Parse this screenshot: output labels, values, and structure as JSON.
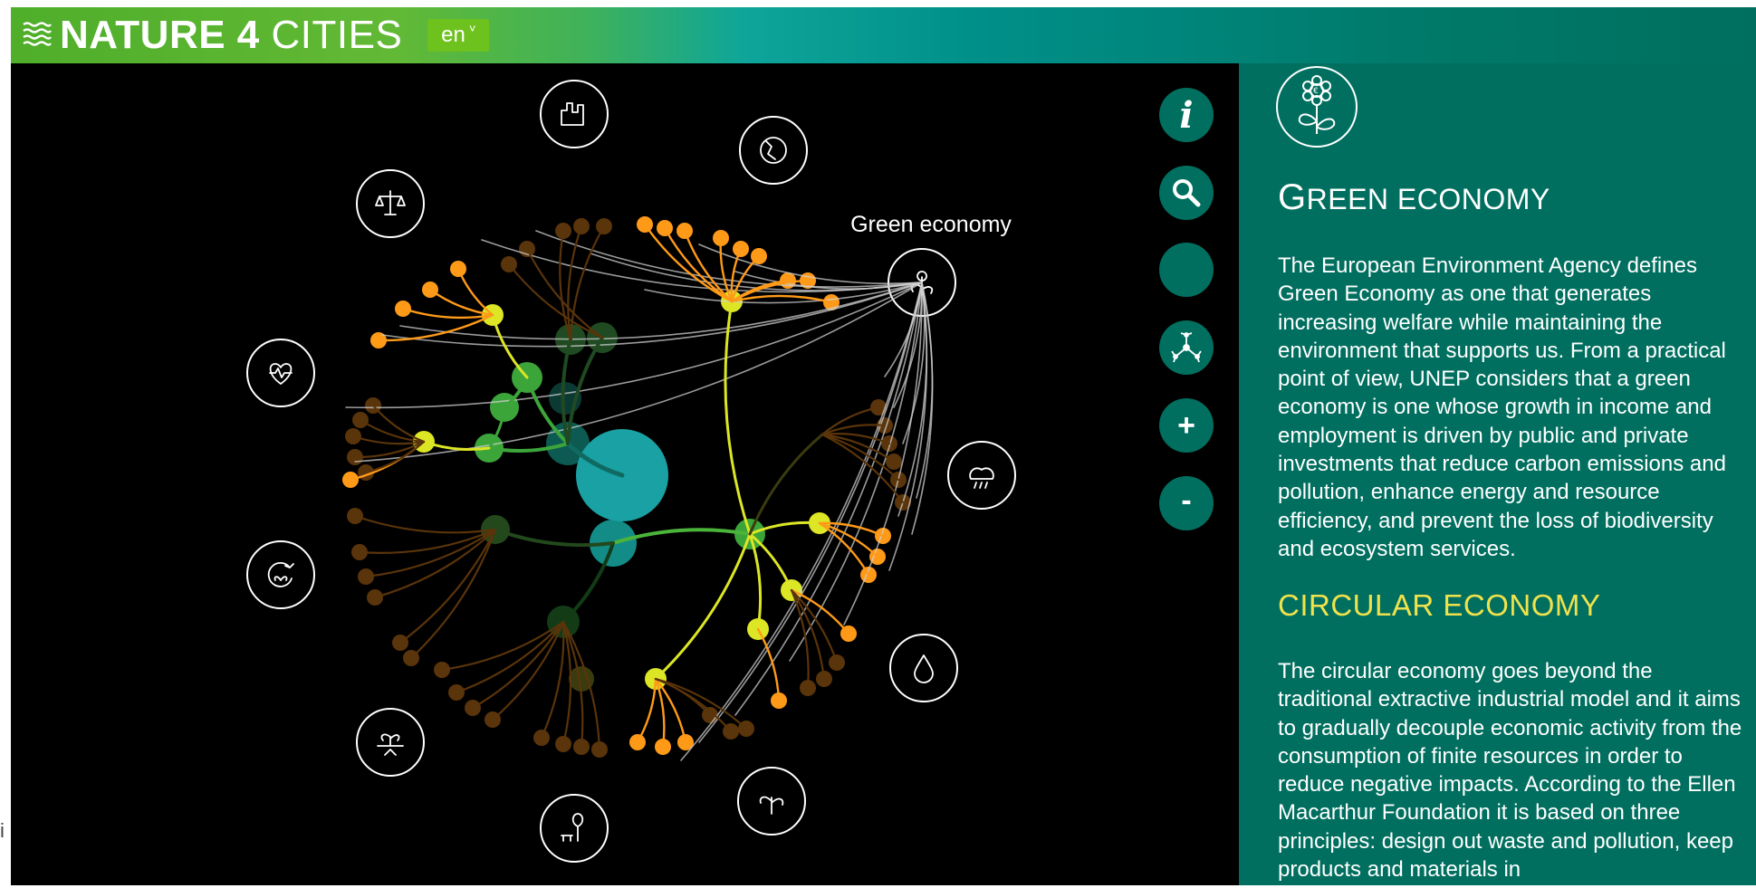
{
  "header": {
    "logo": {
      "bold": "NATURE 4",
      "light": "CITIES"
    },
    "language": {
      "selected": "en",
      "chevron": "˅"
    }
  },
  "viz": {
    "hover_label": "Green economy",
    "hub_icons": [
      "city-buildings-icon",
      "earth-map-icon",
      "economy-flower-icon",
      "climate-weather-icon",
      "water-drop-icon",
      "biodiversity-icon",
      "urban-green-icon",
      "soil-plant-icon",
      "circular-cycle-icon",
      "health-heart-icon",
      "justice-scales-icon"
    ],
    "colors": {
      "orange": "#ff9a18",
      "yellow": "#dce625",
      "green": "#3ca53a",
      "teal": "#1aa1a4",
      "brown": "#5a340a"
    }
  },
  "controls": {
    "info_label": "i",
    "plus_label": "+",
    "minus_label": "-"
  },
  "sidebar": {
    "title_cap": "G",
    "title_rest": "REEN ECONOMY",
    "paragraph1": "The European Environment Agency defines Green Economy as one that generates increasing welfare while maintaining the environment that supports us. From a practical point of view, UNEP considers that a green economy is one whose growth in income and employment is driven by public and private investments that reduce carbon emissions and pollution, enhance energy and resource efficiency, and prevent the loss of biodiversity and ecosystem services.",
    "title2": "CIRCULAR ECONOMY",
    "paragraph2": "The circular economy goes beyond the traditional extractive industrial model and it aims to gradually decouple economic activity from the consumption of finite resources in order to reduce negative impacts. According to the Ellen Macarthur Foundation it is based on three principles: design out waste and pollution, keep products and materials in"
  },
  "edge_mark": "i"
}
